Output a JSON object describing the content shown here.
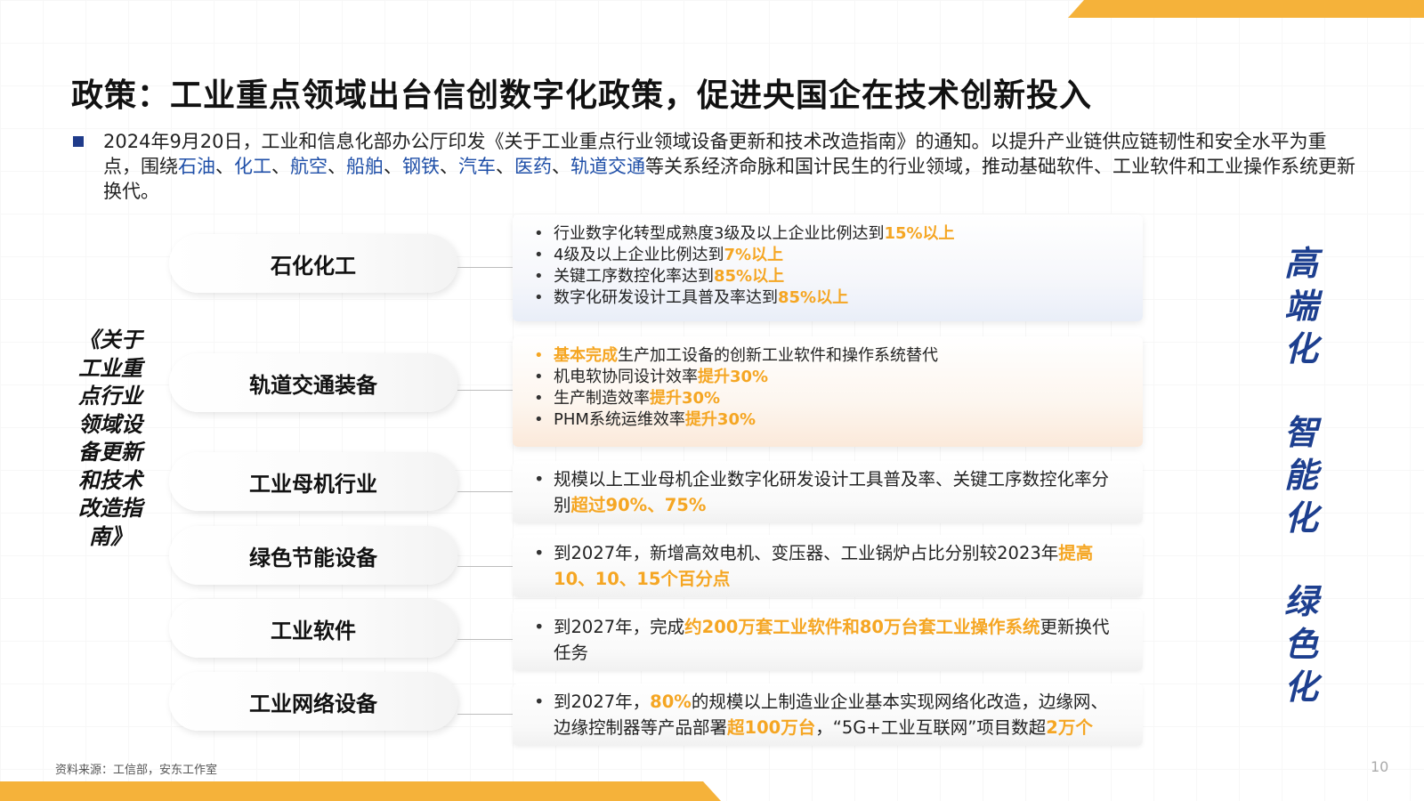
{
  "slide": {
    "title": "政策：工业重点领域出台信创数字化政策，促进央国企在技术创新投入",
    "intro": {
      "prefix": "2024年9月20日，工业和信息化部办公厅印发《关于工业重点行业领域设备更新和技术改造指南》的通知。以提升产业链供应链韧性和安全水平为重点，围绕",
      "industries": [
        "石油",
        "化工",
        "航空",
        "船舶",
        "钢铁",
        "汽车",
        "医药",
        "轨道交通"
      ],
      "separator": "、",
      "suffix": "等关系经济命脉和国计民生的行业领域，推动基础软件、工业软件和工业操作系统更新换代。"
    },
    "side_label": "《关于工业重点行业领域设备更新和技术改造指南》",
    "sections": [
      {
        "category": "石化化工",
        "bullets": [
          {
            "text": "行业数字化转型成熟度3级及以上企业比例达到",
            "accent": "15%以上"
          },
          {
            "text": "4级及以上企业比例达到",
            "accent": "7%以上"
          },
          {
            "text": "关键工序数控化率达到",
            "accent": "85%以上"
          },
          {
            "text": "数字化研发设计工具普及率达到",
            "accent": "85%以上"
          }
        ]
      },
      {
        "category": "轨道交通装备",
        "bullets": [
          {
            "accent": "基本完成",
            "text": "生产加工设备的创新工业软件和操作系统替代"
          },
          {
            "text": "机电软协同设计效率",
            "accent": "提升30%"
          },
          {
            "text": "生产制造效率",
            "accent": "提升30%"
          },
          {
            "text": "PHM系统运维效率",
            "accent": "提升30%"
          }
        ]
      },
      {
        "category": "工业母机行业",
        "bullet": {
          "text": "规模以上工业母机企业数字化研发设计工具普及率、关键工序数控化率分别",
          "accent": "超过90%、75%"
        }
      },
      {
        "category": "绿色节能设备",
        "bullet": {
          "text": "到2027年，新增高效电机、变压器、工业锅炉占比分别较2023年",
          "accent": "提高10、10、15个百分点"
        }
      },
      {
        "category": "工业软件",
        "bullet": {
          "text": "到2027年，完成",
          "accent": "约200万套工业软件和80万台套工业操作系统",
          "tail": "更新换代任务"
        }
      },
      {
        "category": "工业网络设备",
        "bullet": {
          "t1": "到2027年，",
          "a1": "80%",
          "t2": "的规模以上制造业企业基本实现网络化改造，边缘网、边缘控制器等产品部署",
          "a2": "超100万台",
          "t3": "，“5G+工业互联网”项目数超",
          "a3": "2万个"
        }
      }
    ],
    "right_keywords": [
      "高端化",
      "智能化",
      "绿色化"
    ],
    "source": "资料来源：工信部，安东工作室",
    "page_number": "10"
  },
  "colors": {
    "accent": "#f5a623",
    "title_blue": "#1d3f8f",
    "link_blue": "#1f4fa8",
    "bar": "#f5b23a"
  }
}
